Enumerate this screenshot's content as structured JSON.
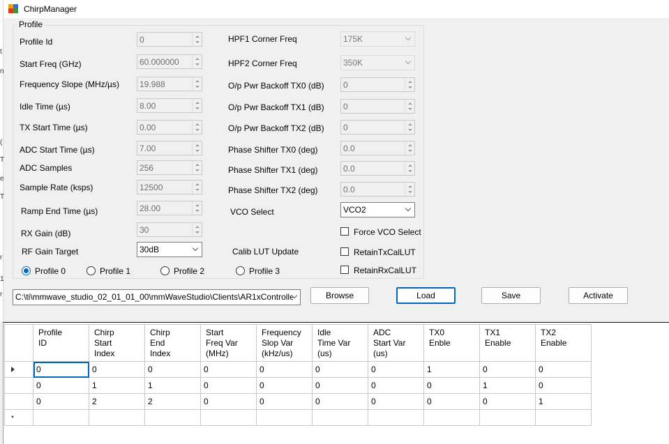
{
  "window": {
    "title": "ChirpManager"
  },
  "left_strip": {
    "chars": [
      "t",
      "n",
      "(",
      "T",
      "e",
      "T",
      "r",
      "1",
      "r"
    ]
  },
  "profile": {
    "group_label": "Profile",
    "left_fields": [
      {
        "label": "Profile Id",
        "value": "0"
      },
      {
        "label": "Start Freq (GHz)",
        "value": "60.000000"
      },
      {
        "label": "Frequency Slope (MHz/µs)",
        "value": "19.988"
      },
      {
        "label": "Idle Time (µs)",
        "value": "8.00"
      },
      {
        "label": "TX Start Time (µs)",
        "value": "0.00"
      },
      {
        "label": "ADC Start Time (µs)",
        "value": "7.00"
      },
      {
        "label": "ADC Samples",
        "value": "256"
      },
      {
        "label": "Sample Rate (ksps)",
        "value": "12500"
      },
      {
        "label": "Ramp End Time (µs)",
        "value": "28.00"
      },
      {
        "label": "RX Gain (dB)",
        "value": "30"
      }
    ],
    "rf_gain": {
      "label": "RF Gain Target",
      "value": "30dB"
    },
    "hpf1": {
      "label": "HPF1 Corner Freq",
      "value": "175K"
    },
    "hpf2": {
      "label": "HPF2 Corner Freq",
      "value": "350K"
    },
    "right_fields": [
      {
        "label": "O/p Pwr Backoff TX0 (dB)",
        "value": "0"
      },
      {
        "label": "O/p Pwr Backoff TX1 (dB)",
        "value": "0"
      },
      {
        "label": "O/p Pwr Backoff TX2 (dB)",
        "value": "0"
      },
      {
        "label": "Phase Shifter TX0 (deg)",
        "value": "0.0"
      },
      {
        "label": "Phase Shifter TX1 (deg)",
        "value": "0.0"
      },
      {
        "label": "Phase Shifter TX2 (deg)",
        "value": "0.0"
      }
    ],
    "vco": {
      "label": "VCO Select",
      "value": "VCO2"
    },
    "force_vco": {
      "label": "Force VCO Select",
      "checked": false
    },
    "calib_lut": {
      "label": "Calib LUT Update"
    },
    "retain_tx": {
      "label": "RetainTxCalLUT",
      "checked": false
    },
    "retain_rx": {
      "label": "RetainRxCalLUT",
      "checked": false
    },
    "radios": [
      "Profile 0",
      "Profile 1",
      "Profile 2",
      "Profile 3"
    ],
    "selected_radio": 0
  },
  "file": {
    "path": "C:\\ti\\mmwave_studio_02_01_01_00\\mmWaveStudio\\Clients\\AR1xController\\"
  },
  "buttons": {
    "browse": "Browse",
    "load": "Load",
    "save": "Save",
    "activate": "Activate"
  },
  "grid": {
    "headers": [
      [
        "Profile",
        "ID"
      ],
      [
        "Chirp",
        "Start",
        "Index"
      ],
      [
        "Chirp",
        "End",
        "Index"
      ],
      [
        "Start",
        "Freq Var",
        "(MHz)"
      ],
      [
        "Frequency",
        "Slop Var",
        "(kHz/us)"
      ],
      [
        "Idle",
        "Time Var",
        "(us)"
      ],
      [
        "ADC",
        "Start Var",
        "(us)"
      ],
      [
        "TX0",
        "Enble"
      ],
      [
        "TX1",
        "Enable"
      ],
      [
        "TX2",
        "Enable"
      ]
    ],
    "rows": [
      [
        "0",
        "0",
        "0",
        "0",
        "0",
        "0",
        "0",
        "1",
        "0",
        "0"
      ],
      [
        "0",
        "1",
        "1",
        "0",
        "0",
        "0",
        "0",
        "0",
        "1",
        "0"
      ],
      [
        "0",
        "2",
        "2",
        "0",
        "0",
        "0",
        "0",
        "0",
        "0",
        "1"
      ]
    ],
    "new_row_marker": "*"
  }
}
